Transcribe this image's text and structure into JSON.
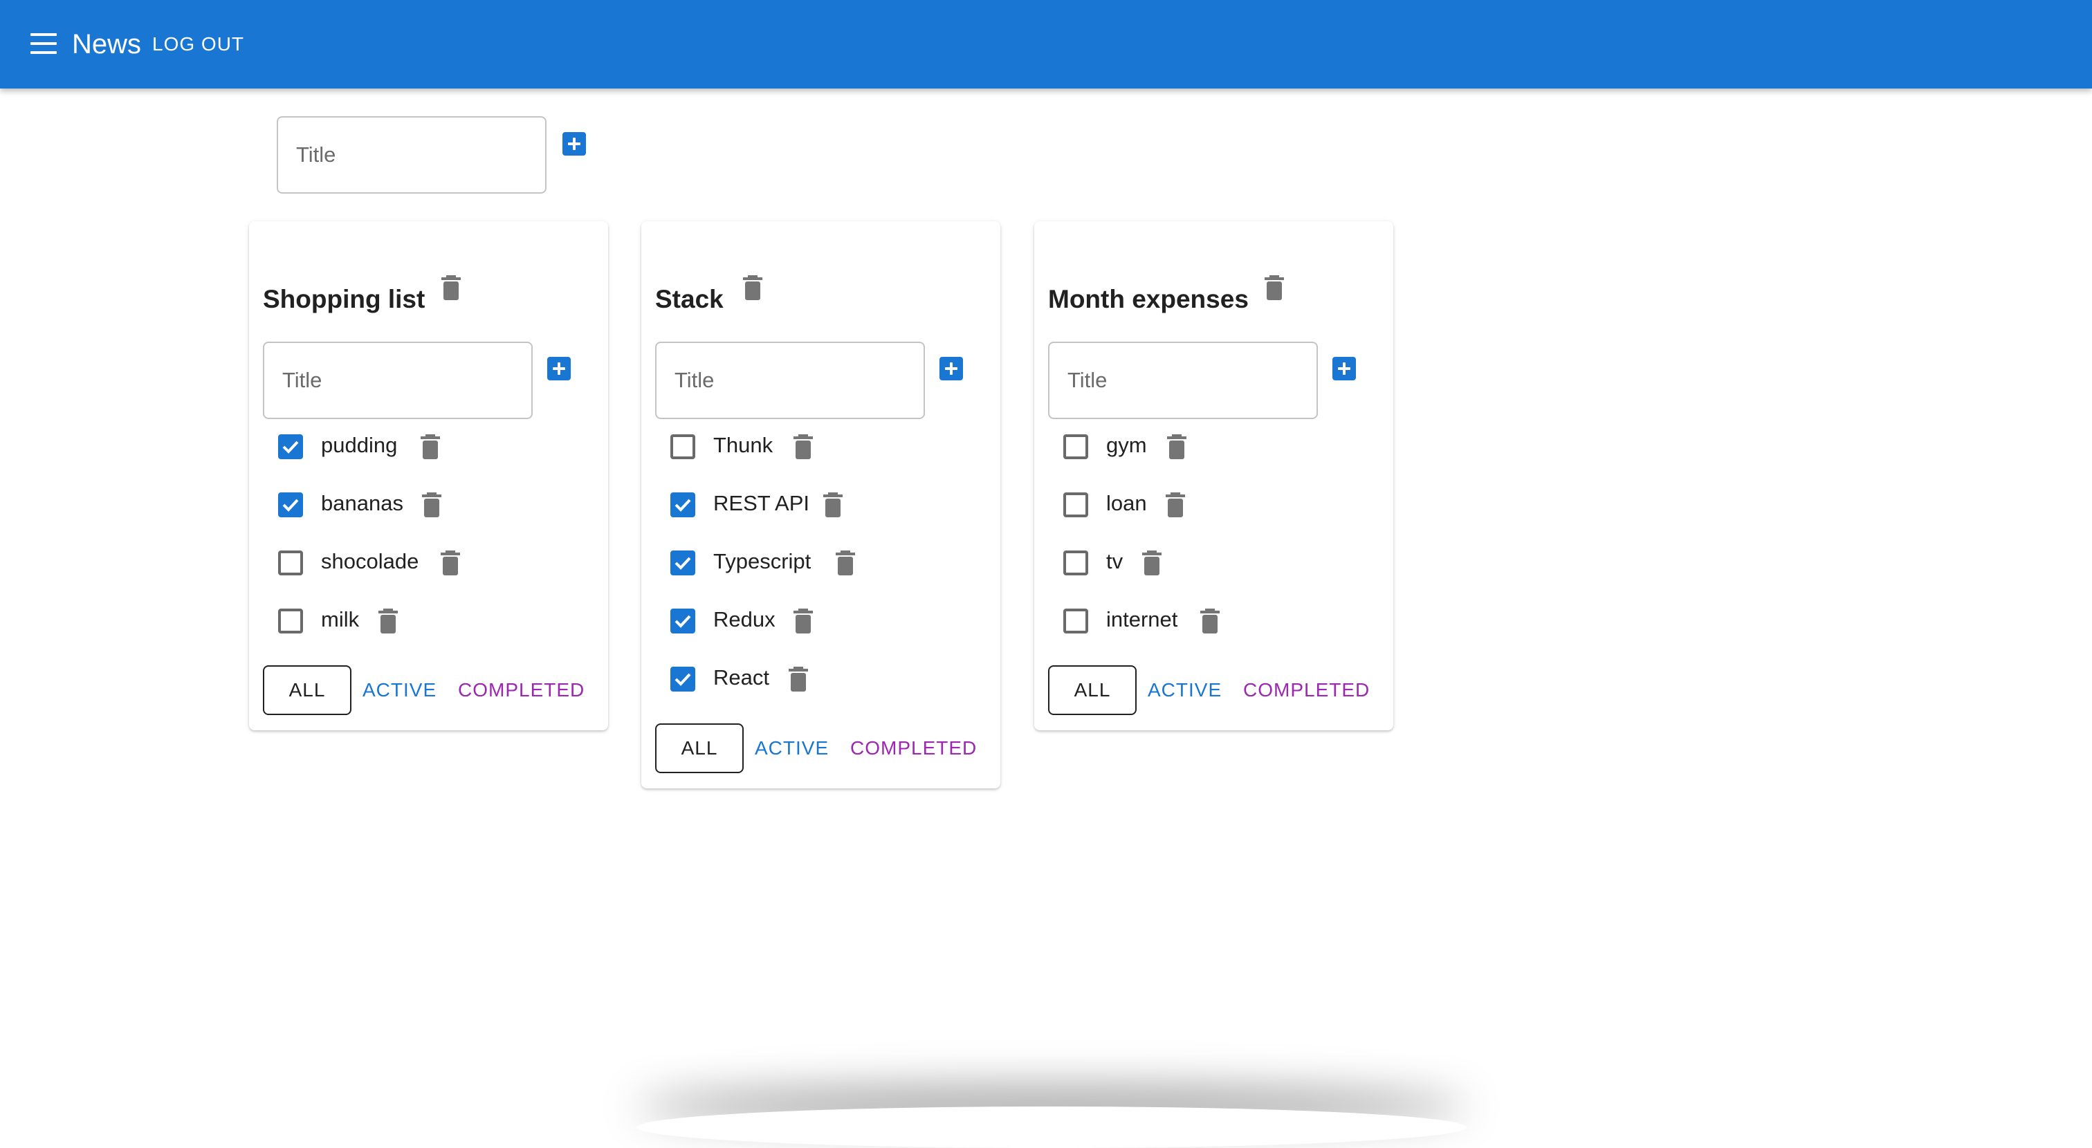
{
  "appbar": {
    "title": "News",
    "logout_label": "LOG OUT",
    "color": "#1976d2"
  },
  "add_list": {
    "placeholder": "Title"
  },
  "filters": {
    "all": "ALL",
    "active": "ACTIVE",
    "completed": "COMPLETED"
  },
  "lists": [
    {
      "title": "Shopping list",
      "input_placeholder": "Title",
      "tasks": [
        {
          "label": "pudding",
          "checked": true
        },
        {
          "label": "bananas",
          "checked": true
        },
        {
          "label": "shocolade",
          "checked": false
        },
        {
          "label": "milk",
          "checked": false
        }
      ]
    },
    {
      "title": "Stack",
      "input_placeholder": "Title",
      "tasks": [
        {
          "label": "Thunk",
          "checked": false
        },
        {
          "label": "REST API",
          "checked": true
        },
        {
          "label": "Typescript",
          "checked": true
        },
        {
          "label": "Redux",
          "checked": true
        },
        {
          "label": "React",
          "checked": true
        }
      ]
    },
    {
      "title": "Month expenses",
      "input_placeholder": "Title",
      "tasks": [
        {
          "label": "gym",
          "checked": false
        },
        {
          "label": "loan",
          "checked": false
        },
        {
          "label": "tv",
          "checked": false
        },
        {
          "label": "internet",
          "checked": false
        }
      ]
    }
  ]
}
